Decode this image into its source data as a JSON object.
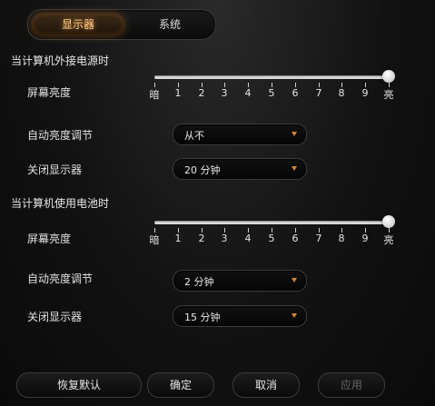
{
  "tabs": [
    {
      "label": "显示器",
      "active": true
    },
    {
      "label": "系统",
      "active": false
    }
  ],
  "accent_color": "#e0822a",
  "plugged_in": {
    "title": "当计算机外接电源时",
    "brightness_label": "屏幕亮度",
    "brightness_level": 10,
    "auto_brightness_label": "自动亮度调节",
    "auto_brightness_value": "从不",
    "display_off_label": "关闭显示器",
    "display_off_value": "20 分钟"
  },
  "on_battery": {
    "title": "当计算机使用电池时",
    "brightness_label": "屏幕亮度",
    "brightness_level": 10,
    "auto_brightness_label": "自动亮度调节",
    "auto_brightness_value": "2 分钟",
    "display_off_label": "关闭显示器",
    "display_off_value": "15 分钟"
  },
  "scale_labels": [
    "暗",
    "1",
    "2",
    "3",
    "4",
    "5",
    "6",
    "7",
    "8",
    "9",
    "亮"
  ],
  "buttons": {
    "restore_default": "恢复默认",
    "ok": "确定",
    "cancel": "取消",
    "apply": "应用"
  }
}
